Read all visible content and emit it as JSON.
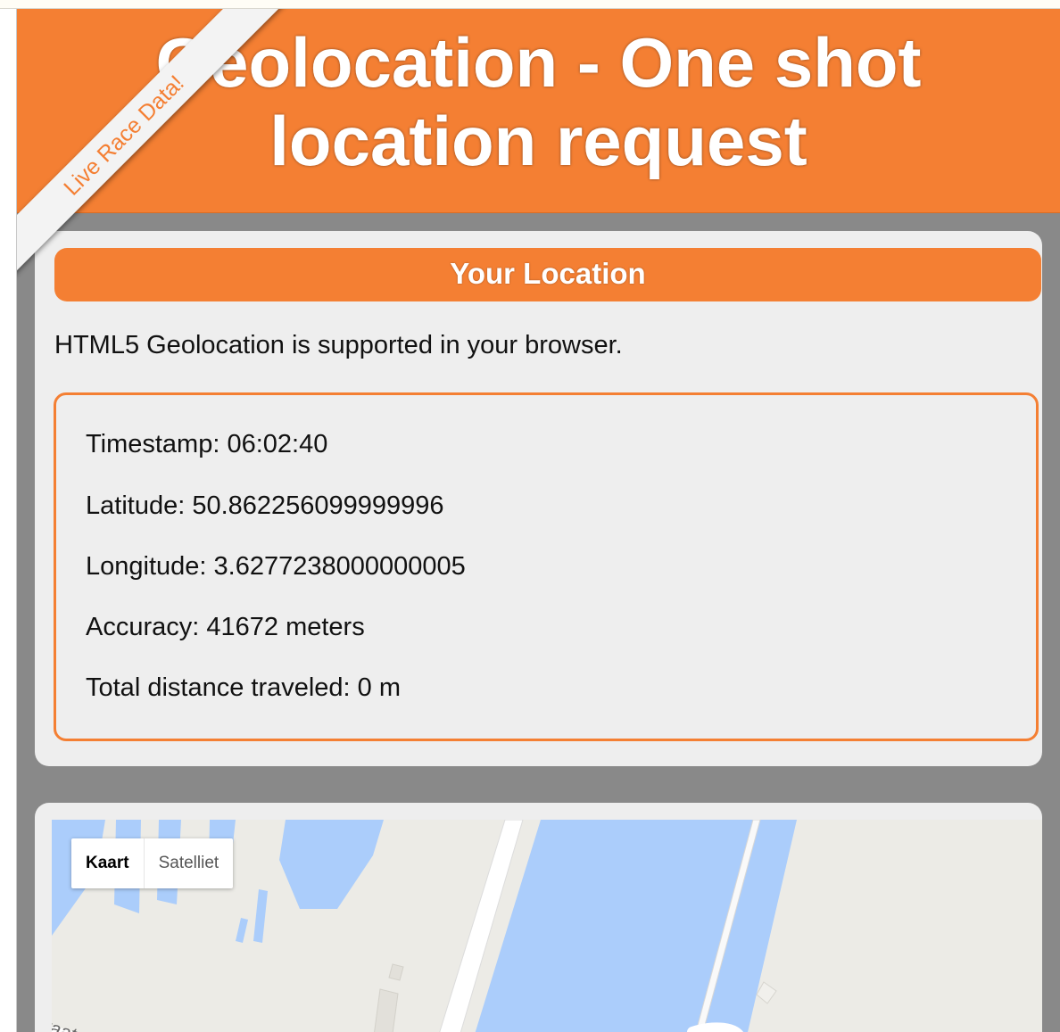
{
  "header": {
    "title_line1": "Geolocation - One shot",
    "title_line2": "location request"
  },
  "ribbon": {
    "label": "Live Race Data!"
  },
  "location_panel": {
    "title": "Your Location",
    "support_message": "HTML5 Geolocation is supported in your browser.",
    "timestamp_line": "Timestamp: 06:02:40",
    "latitude_line": "Latitude: 50.862256099999996",
    "longitude_line": "Longitude: 3.6277238000000005",
    "accuracy_line": "Accuracy: 41672 meters",
    "distance_line": "Total distance traveled: 0 m"
  },
  "map": {
    "type_controls": [
      "Kaart",
      "Satelliet"
    ],
    "selected_type": "Kaart",
    "street_label": "traat",
    "colors": {
      "land": "#ecebe6",
      "water": "#abcdfb",
      "road": "#ffffff"
    }
  },
  "colors": {
    "accent": "#f47f33",
    "page_background": "#898989",
    "panel_background": "#eeeeee"
  }
}
